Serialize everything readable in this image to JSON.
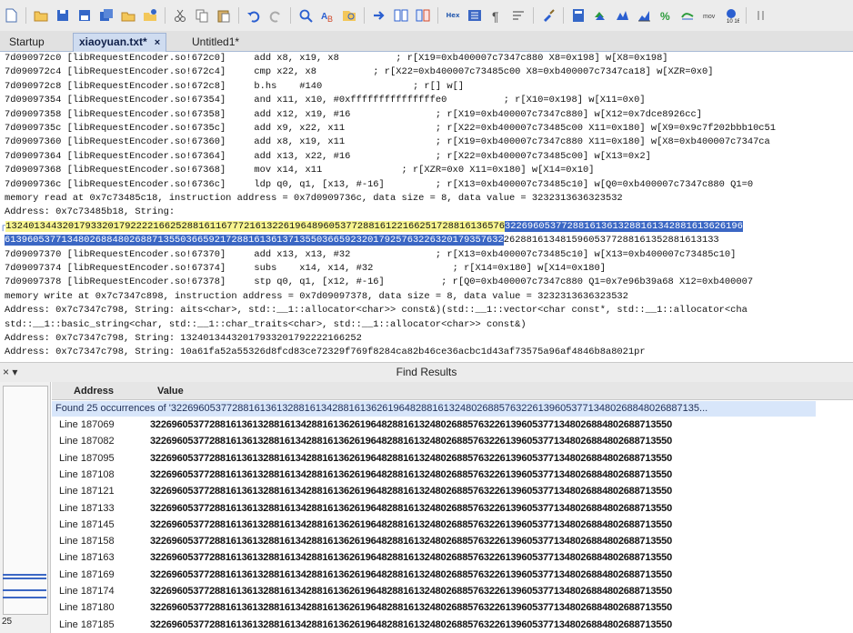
{
  "toolbar": {
    "icons": [
      "new-file-icon",
      "open-folder-icon",
      "save-icon",
      "save-as-icon",
      "save-all-icon",
      "open-file-icon",
      "open-recent-icon",
      "cut-icon",
      "copy-icon",
      "paste-icon",
      "undo-icon",
      "redo-icon",
      "find-icon",
      "find-replace-icon",
      "find-in-files-icon",
      "goto-icon",
      "compare-icon",
      "compare-files-icon",
      "hex-icon",
      "column-mode-icon",
      "show-formatting-icon",
      "word-wrap-icon",
      "brush-icon",
      "calculator-icon",
      "convert-icon",
      "code-icon",
      "chart-icon",
      "percent-icon",
      "format-icon",
      "macro-icon",
      "register-icon",
      "pause-icon"
    ],
    "hex_label": "Hex",
    "mov_label": "mov",
    "reg_label": "10 16"
  },
  "tabs": [
    {
      "label": "Startup",
      "active": false
    },
    {
      "label": "xiaoyuan.txt*",
      "active": true,
      "close": "×"
    },
    {
      "label": "Untitled1*",
      "active": false
    }
  ],
  "editor": {
    "lines": [
      {
        "text": "7d090972c0 [libRequestEncoder.so!672c0]     add x8, x19, x8          ; r[X19=0xb400007c7347c880 X8=0x198] w[X8=0x198]"
      },
      {
        "text": "7d090972c4 [libRequestEncoder.so!672c4]     cmp x22, x8          ; r[X22=0xb400007c73485c00 X8=0xb400007c7347ca18] w[XZR=0x0]"
      },
      {
        "text": "7d090972c8 [libRequestEncoder.so!672c8]     b.hs    #140                ; r[] w[]"
      },
      {
        "text": "7d09097354 [libRequestEncoder.so!67354]     and x11, x10, #0xfffffffffffffffe0          ; r[X10=0x198] w[X11=0x0]"
      },
      {
        "text": "7d09097358 [libRequestEncoder.so!67358]     add x12, x19, #16               ; r[X19=0xb400007c7347c880] w[X12=0x7dce8926cc]"
      },
      {
        "text": "7d0909735c [libRequestEncoder.so!6735c]     add x9, x22, x11                ; r[X22=0xb400007c73485c00 X11=0x180] w[X9=0x9c7f202bbb10c51"
      },
      {
        "text": "7d09097360 [libRequestEncoder.so!67360]     add x8, x19, x11                ; r[X19=0xb400007c7347c880 X11=0x180] w[X8=0xb400007c7347ca"
      },
      {
        "text": "7d09097364 [libRequestEncoder.so!67364]     add x13, x22, #16               ; r[X22=0xb400007c73485c00] w[X13=0x2]"
      },
      {
        "text": "7d09097368 [libRequestEncoder.so!67368]     mov x14, x11              ; r[XZR=0x0 X11=0x180] w[X14=0x10]"
      },
      {
        "text": "7d0909736c [libRequestEncoder.so!6736c]     ldp q0, q1, [x13, #-16]         ; r[X13=0xb400007c73485c10] w[Q0=0xb400007c7347c880 Q1=0"
      },
      {
        "text": "memory read at 0x7c73485c18, instruction address = 0x7d0909736c, data size = 8, data value = 3232313636323532"
      },
      {
        "text": "Address: 0x7c73485b18, String:"
      },
      {
        "yellow": "1324013443201793320179222216625288161167772161322619648960537728816122166251728816136576",
        "blue": "322696053772881613613288161342881613626196",
        "mark": "┌"
      },
      {
        "blue": "6139605377134802688480268871355036659217288161361371355036659232017925763226320179357632",
        "rest": "26288161348159605377288161352881613133"
      },
      {
        "text": "7d09097370 [libRequestEncoder.so!67370]     add x13, x13, #32               ; r[X13=0xb400007c73485c10] w[X13=0xb400007c73485c10]"
      },
      {
        "text": "7d09097374 [libRequestEncoder.so!67374]     subs    x14, x14, #32              ; r[X14=0x180] w[X14=0x180]"
      },
      {
        "text": "7d09097378 [libRequestEncoder.so!67378]     stp q0, q1, [x12, #-16]          ; r[Q0=0xb400007c7347c880 Q1=0x7e96b39a68 X12=0xb400007"
      },
      {
        "text": "memory write at 0x7c7347c898, instruction address = 0x7d09097378, data size = 8, data value = 3232313636323532"
      },
      {
        "text": "Address: 0x7c7347c798, String: aits<char>, std::__1::allocator<char>> const&)(std::__1::vector<char const*, std::__1::allocator<cha"
      },
      {
        "text": "std::__1::basic_string<char, std::__1::char_traits<char>, std::__1::allocator<char>> const&)"
      },
      {
        "text": "Address: 0x7c7347c798, String: 13240134432017933201792222166252"
      },
      {
        "text": "Address: 0x7c7347c798, String: 10a61fa52a55326d8fcd83ce72329f769f8284ca82b46ce36acbc1d43af73575a96af4846b8a8021pr"
      }
    ]
  },
  "find_panel": {
    "close_label": "× ▾",
    "title": "Find Results",
    "col_address": "Address",
    "col_value": "Value",
    "summary": "Found 25 occurrences of '32269605377288161361328816134288161362619648288161324802688576322613960537713480268848026887135...",
    "count": "25",
    "value_text": "3226960537728816136132881613428816136261964828816132480268857632261396053771348026884802688713550",
    "rows": [
      "Line 187069",
      "Line 187082",
      "Line 187095",
      "Line 187108",
      "Line 187121",
      "Line 187133",
      "Line 187145",
      "Line 187158",
      "Line 187163",
      "Line 187169",
      "Line 187174",
      "Line 187180",
      "Line 187185"
    ]
  }
}
